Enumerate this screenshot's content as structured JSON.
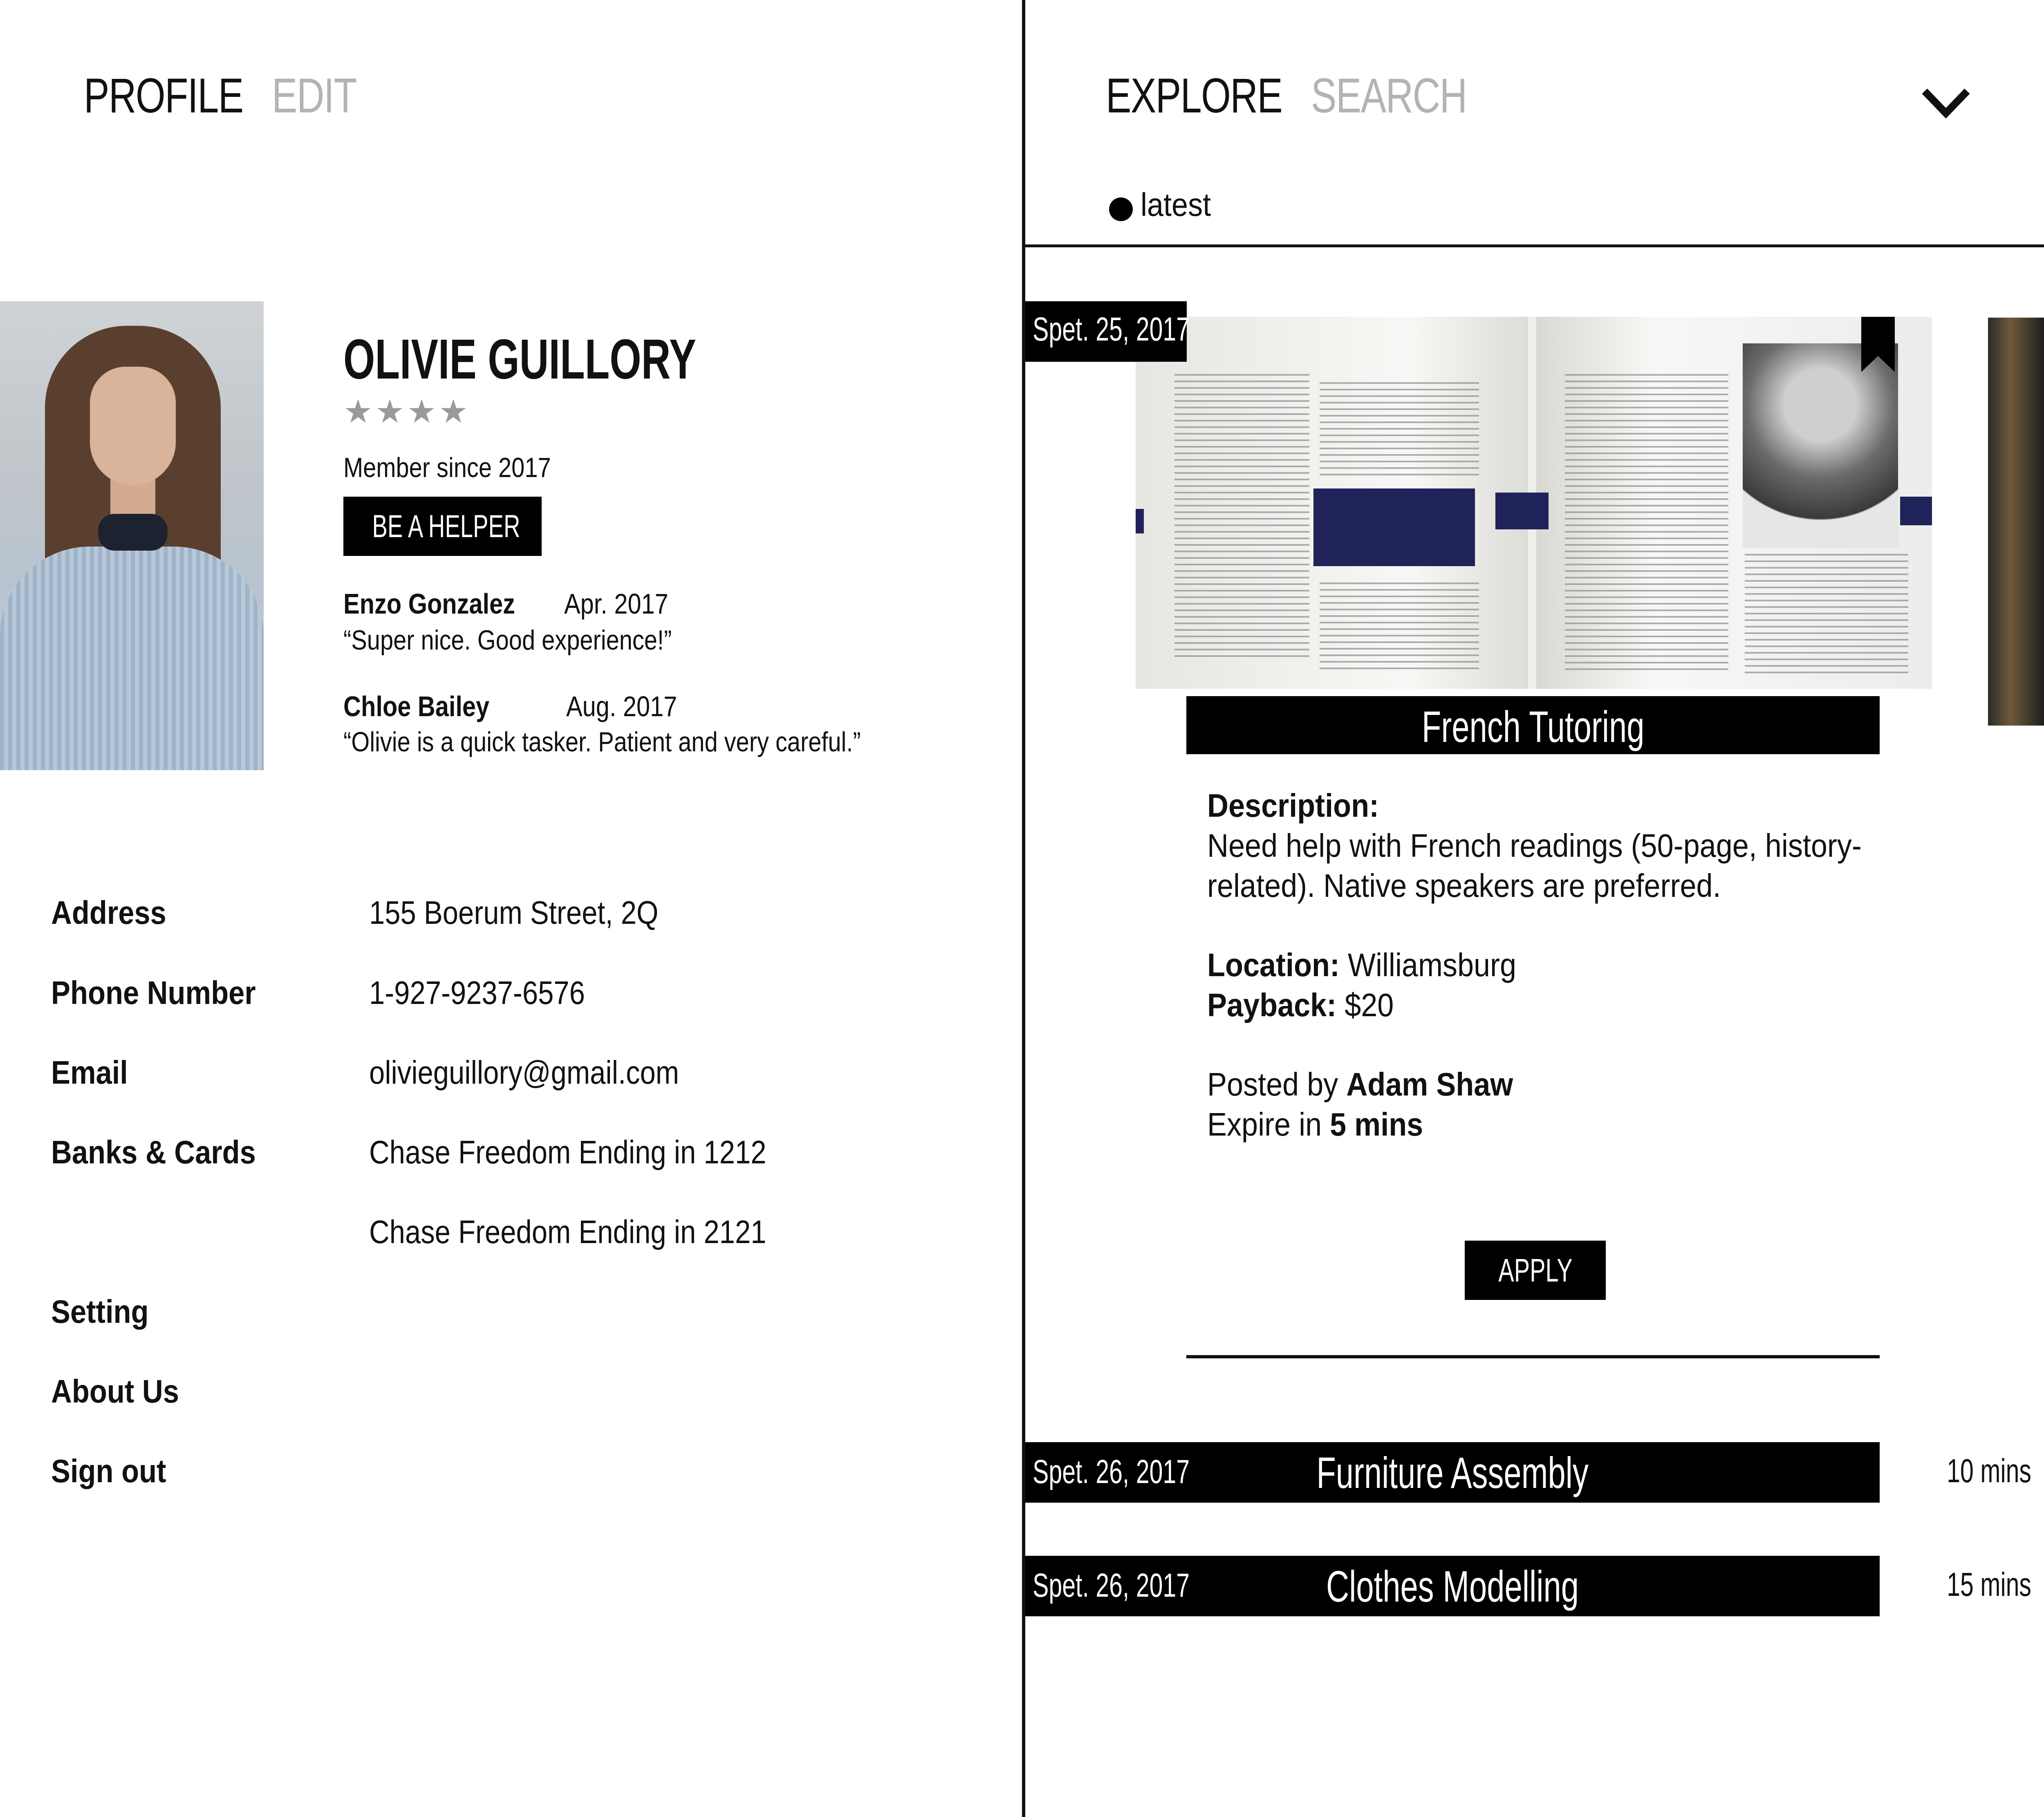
{
  "profile_panel": {
    "tabs": {
      "profile": "PROFILE",
      "edit": "EDIT"
    },
    "name": "OLIVIE GUILLORY",
    "stars": "★★★★",
    "member_since": "Member since 2017",
    "helper_button": "BE A HELPER",
    "reviews": [
      {
        "name": "Enzo Gonzalez",
        "date": "Apr. 2017",
        "text": "“Super nice. Good experience!”"
      },
      {
        "name": "Chloe Bailey",
        "date": "Aug. 2017",
        "text": "“Olivie is a quick tasker. Patient and very careful.”"
      }
    ],
    "info": {
      "address_label": "Address",
      "address_value": "155 Boerum Street, 2Q",
      "phone_label": "Phone Number",
      "phone_value": "1-927-9237-6576",
      "email_label": "Email",
      "email_value": "olivieguillory@gmail.com",
      "banks_label": "Banks & Cards",
      "bank_1": "Chase Freedom Ending in 1212",
      "bank_2": "Chase Freedom Ending in 2121"
    },
    "menu": {
      "setting": "Setting",
      "about": "About Us",
      "sign_out": "Sign out"
    }
  },
  "explore_panel": {
    "tabs": {
      "explore": "EXPLORE",
      "search": "SEARCH"
    },
    "chevron_icon": "chevron-down-icon",
    "filter": "latest",
    "featured": {
      "date": "Spet. 25, 2017",
      "title": "French Tutoring",
      "description_label": "Description:",
      "description_line1": "Need help with French readings (50-page, history-",
      "description_line2": "related). Native speakers are preferred.",
      "location_label": "Location:",
      "location_value": "Williamsburg",
      "payback_label": "Payback:",
      "payback_value": "$20",
      "posted_prefix": "Posted by",
      "posted_by": "Adam Shaw",
      "expire_prefix": "Expire in",
      "expire_value": "5 mins",
      "apply_button": "APPLY"
    },
    "tasks": [
      {
        "date": "Spet. 26, 2017",
        "title": "Furniture Assembly",
        "mins": "10 mins"
      },
      {
        "date": "Spet. 26, 2017",
        "title": "Clothes Modelling",
        "mins": "15 mins"
      }
    ]
  },
  "colors": {
    "accent": "#000000",
    "inactive_tab": "#b3b3b3",
    "star": "#9a9a9a"
  }
}
